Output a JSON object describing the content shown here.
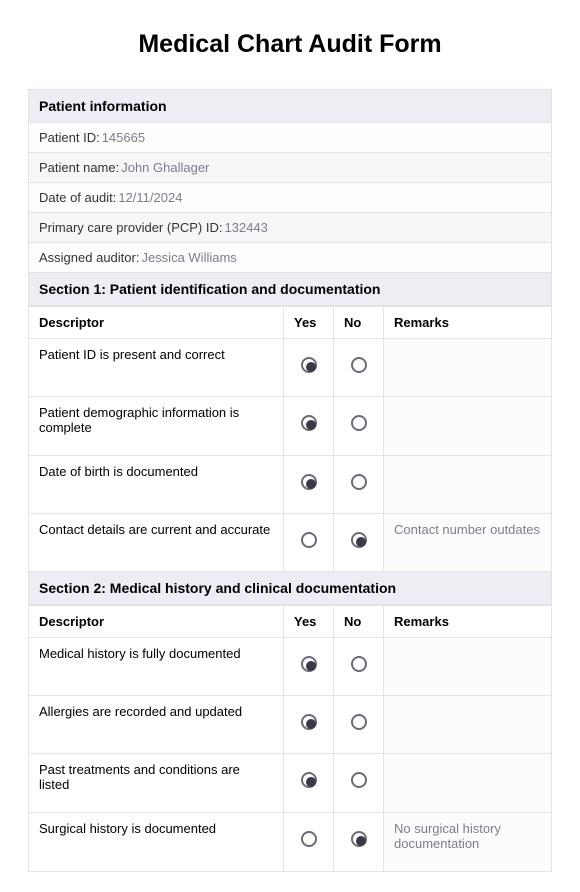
{
  "title": "Medical Chart Audit Form",
  "patient_info": {
    "header": "Patient information",
    "fields": [
      {
        "label": "Patient ID:",
        "value": "145665"
      },
      {
        "label": "Patient name:",
        "value": "John Ghallager"
      },
      {
        "label": "Date of audit:",
        "value": "12/11/2024"
      },
      {
        "label": "Primary care provider (PCP) ID:",
        "value": "132443"
      },
      {
        "label": "Assigned auditor:",
        "value": "Jessica Williams"
      }
    ]
  },
  "columns": {
    "descriptor": "Descriptor",
    "yes": "Yes",
    "no": "No",
    "remarks": "Remarks"
  },
  "sections": [
    {
      "title": "Section 1: Patient identification and documentation",
      "rows": [
        {
          "descriptor": "Patient ID is present and correct",
          "selected": "yes",
          "remarks": ""
        },
        {
          "descriptor": "Patient demographic information is complete",
          "selected": "yes",
          "remarks": ""
        },
        {
          "descriptor": "Date of birth is documented",
          "selected": "yes",
          "remarks": ""
        },
        {
          "descriptor": "Contact details are current and accurate",
          "selected": "no",
          "remarks": "Contact number outdates"
        }
      ]
    },
    {
      "title": "Section 2: Medical history and clinical documentation",
      "rows": [
        {
          "descriptor": "Medical history is fully documented",
          "selected": "yes",
          "remarks": ""
        },
        {
          "descriptor": "Allergies are recorded and updated",
          "selected": "yes",
          "remarks": ""
        },
        {
          "descriptor": "Past treatments and conditions are listed",
          "selected": "yes",
          "remarks": ""
        },
        {
          "descriptor": "Surgical history is documented",
          "selected": "no",
          "remarks": "No surgical history documentation"
        }
      ]
    }
  ]
}
